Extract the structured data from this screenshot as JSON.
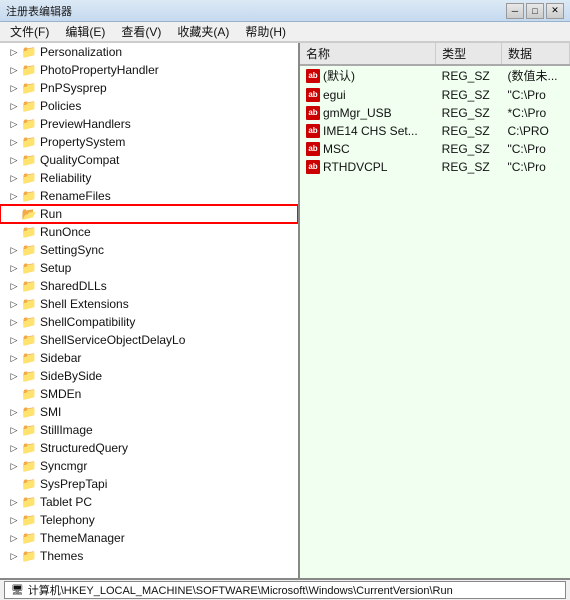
{
  "titleBar": {
    "title": "注册表编辑器",
    "minBtn": "─",
    "maxBtn": "□",
    "closeBtn": "✕"
  },
  "menuBar": {
    "items": [
      "文件(F)",
      "编辑(E)",
      "查看(V)",
      "收藏夹(A)",
      "帮助(H)"
    ]
  },
  "treeItems": [
    {
      "id": "personalization",
      "label": "Personalization",
      "indent": 2,
      "expandable": true,
      "expanded": false
    },
    {
      "id": "photopropertyhandler",
      "label": "PhotoPropertyHandler",
      "indent": 2,
      "expandable": true,
      "expanded": false
    },
    {
      "id": "pnpsysprep",
      "label": "PnPSysprep",
      "indent": 2,
      "expandable": true,
      "expanded": false
    },
    {
      "id": "policies",
      "label": "Policies",
      "indent": 2,
      "expandable": true,
      "expanded": false
    },
    {
      "id": "previewhandlers",
      "label": "PreviewHandlers",
      "indent": 2,
      "expandable": true,
      "expanded": false
    },
    {
      "id": "propertysystem",
      "label": "PropertySystem",
      "indent": 2,
      "expandable": true,
      "expanded": false
    },
    {
      "id": "qualitycompat",
      "label": "QualityCompat",
      "indent": 2,
      "expandable": true,
      "expanded": false
    },
    {
      "id": "reliability",
      "label": "Reliability",
      "indent": 2,
      "expandable": true,
      "expanded": false
    },
    {
      "id": "renamefiles",
      "label": "RenameFiles",
      "indent": 2,
      "expandable": true,
      "expanded": false
    },
    {
      "id": "run",
      "label": "Run",
      "indent": 2,
      "expandable": false,
      "expanded": false,
      "selected": true,
      "highlighted": true
    },
    {
      "id": "runonce",
      "label": "RunOnce",
      "indent": 2,
      "expandable": false,
      "expanded": false
    },
    {
      "id": "settingsync",
      "label": "SettingSync",
      "indent": 2,
      "expandable": true,
      "expanded": false
    },
    {
      "id": "setup",
      "label": "Setup",
      "indent": 2,
      "expandable": true,
      "expanded": false
    },
    {
      "id": "shareddlls",
      "label": "SharedDLLs",
      "indent": 2,
      "expandable": true,
      "expanded": false
    },
    {
      "id": "shellextensions",
      "label": "Shell Extensions",
      "indent": 2,
      "expandable": true,
      "expanded": false
    },
    {
      "id": "shellcompatibility",
      "label": "ShellCompatibility",
      "indent": 2,
      "expandable": true,
      "expanded": false
    },
    {
      "id": "shellserviceobjectdelaylo",
      "label": "ShellServiceObjectDelayLo",
      "indent": 2,
      "expandable": true,
      "expanded": false
    },
    {
      "id": "sidebar",
      "label": "Sidebar",
      "indent": 2,
      "expandable": true,
      "expanded": false
    },
    {
      "id": "sidebyside",
      "label": "SideBySide",
      "indent": 2,
      "expandable": true,
      "expanded": false
    },
    {
      "id": "smden",
      "label": "SMDEn",
      "indent": 2,
      "expandable": false,
      "expanded": false
    },
    {
      "id": "smi",
      "label": "SMI",
      "indent": 2,
      "expandable": true,
      "expanded": false
    },
    {
      "id": "stillimage",
      "label": "StillImage",
      "indent": 2,
      "expandable": true,
      "expanded": false
    },
    {
      "id": "structuredquery",
      "label": "StructuredQuery",
      "indent": 2,
      "expandable": true,
      "expanded": false
    },
    {
      "id": "syncmgr",
      "label": "Syncmgr",
      "indent": 2,
      "expandable": true,
      "expanded": false
    },
    {
      "id": "syspreptapi",
      "label": "SysPrepTapi",
      "indent": 2,
      "expandable": false,
      "expanded": false
    },
    {
      "id": "tabletpc",
      "label": "Tablet PC",
      "indent": 2,
      "expandable": true,
      "expanded": false
    },
    {
      "id": "telephony",
      "label": "Telephony",
      "indent": 2,
      "expandable": true,
      "expanded": false
    },
    {
      "id": "thememanager",
      "label": "ThemeManager",
      "indent": 2,
      "expandable": true,
      "expanded": false
    },
    {
      "id": "themes",
      "label": "Themes",
      "indent": 2,
      "expandable": true,
      "expanded": false
    }
  ],
  "tableHeaders": [
    "名称",
    "类型",
    "数据"
  ],
  "tableRows": [
    {
      "icon": "ab",
      "name": "(默认)",
      "type": "REG_SZ",
      "data": "(数值未..."
    },
    {
      "icon": "ab",
      "name": "egui",
      "type": "REG_SZ",
      "data": "\"C:\\Pro"
    },
    {
      "icon": "ab",
      "name": "gmMgr_USB",
      "type": "REG_SZ",
      "data": "*C:\\Pro"
    },
    {
      "icon": "ab",
      "name": "IME14 CHS Set...",
      "type": "REG_SZ",
      "data": "C:\\PRO"
    },
    {
      "icon": "ab",
      "name": "MSC",
      "type": "REG_SZ",
      "data": "\"C:\\Pro"
    },
    {
      "icon": "ab",
      "name": "RTHDVCPL",
      "type": "REG_SZ",
      "data": "\"C:\\Pro"
    }
  ],
  "statusBar": {
    "path": "计算机\\HKEY_LOCAL_MACHINE\\SOFTWARE\\Microsoft\\Windows\\CurrentVersion\\Run"
  }
}
